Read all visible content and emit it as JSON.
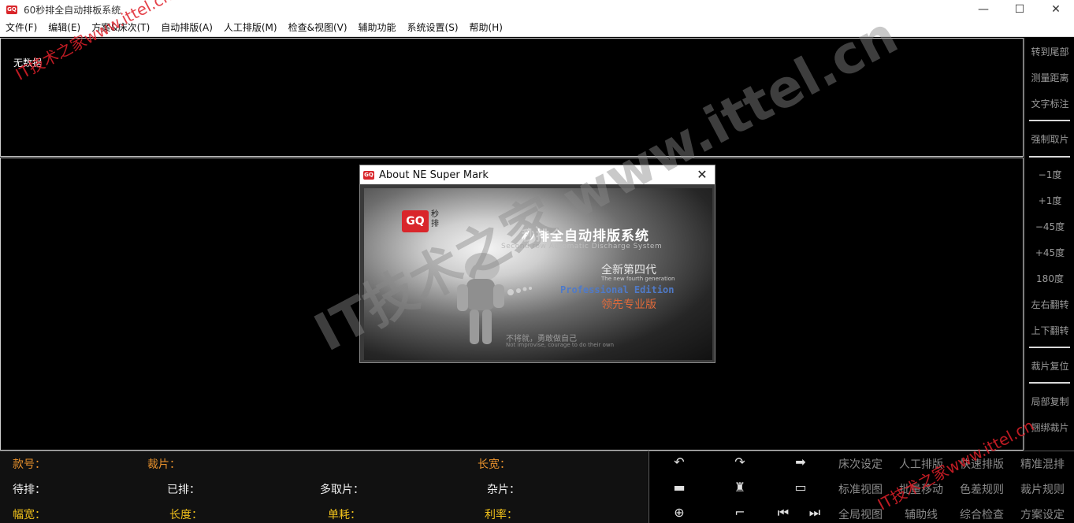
{
  "titlebar": {
    "app_icon": "GQ",
    "title": "60秒排全自动排板系统",
    "minimize": "—",
    "maximize": "☐",
    "close": "✕"
  },
  "menu": [
    "文件(F)",
    "编辑(E)",
    "方案&床次(T)",
    "自动排版(A)",
    "人工排版(M)",
    "检查&视图(V)",
    "辅助功能",
    "系统设置(S)",
    "帮助(H)"
  ],
  "top_panel": {
    "status": "无数据"
  },
  "right_bar": {
    "items": [
      "转到尾部",
      "测量距离",
      "文字标注",
      "强制取片",
      "−1度",
      "+1度",
      "−45度",
      "+45度",
      "180度",
      "左右翻转",
      "上下翻转",
      "裁片复位",
      "局部复制",
      "捆绑裁片"
    ]
  },
  "about": {
    "title": "About NE Super Mark",
    "close": "✕",
    "logo": "GQ",
    "logo_sub": "秒排",
    "product": "秒排全自动排版系统",
    "product_en": "Second row Automatic Discharge System",
    "generation": "全新第四代",
    "generation_en": "The new fourth generation",
    "edition": "Professional Edition",
    "edition_cn": "领先专业版",
    "motto": "不将就，勇敢做自己",
    "motto_en": "Not improvise, courage to do their own"
  },
  "bottom_info": {
    "style_no": "款号：",
    "piece": "裁片：",
    "length_width": "长宽：",
    "pending": "待排：",
    "placed": "已排：",
    "multi_pick": "多取片：",
    "misc": "杂片：",
    "width": "幅宽：",
    "length": "长度：",
    "unit_consumption": "单耗：",
    "utilization": "利率："
  },
  "bottom_tools": {
    "labels": [
      "床次设定",
      "人工排版",
      "快速排版",
      "精准混排",
      "标准视图",
      "批量移动",
      "色差规则",
      "裁片规则",
      "全局视图",
      "辅助线",
      "综合检查",
      "方案设定"
    ]
  },
  "watermarks": {
    "top_left": "IT技术之家www.ittel.cn",
    "center": "IT技术之家 www.ittel.cn",
    "bottom_right": "IT技术之家www.ittel.cn"
  },
  "colors": {
    "accent_orange": "#e8912c",
    "accent_yellow": "#f2c21b",
    "brand_red": "#d9262b",
    "watermark_red": "#e0202a"
  }
}
